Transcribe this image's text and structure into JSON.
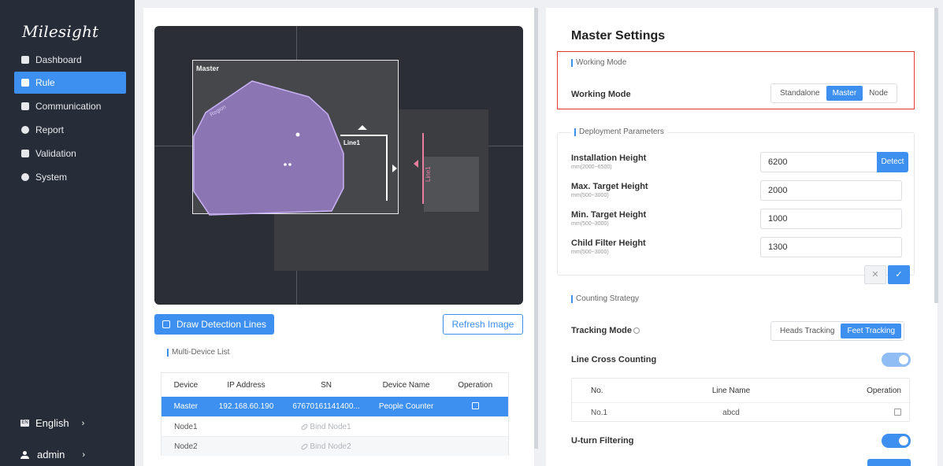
{
  "brand": "Milesight",
  "sidebar": {
    "items": [
      {
        "label": "Dashboard",
        "icon": "dashboard-icon"
      },
      {
        "label": "Rule",
        "icon": "rule-icon",
        "active": true
      },
      {
        "label": "Communication",
        "icon": "communication-icon"
      },
      {
        "label": "Report",
        "icon": "report-icon"
      },
      {
        "label": "Validation",
        "icon": "validation-icon"
      },
      {
        "label": "System",
        "icon": "gear-icon"
      }
    ],
    "language": "English",
    "user": "admin"
  },
  "preview": {
    "master_label": "Master",
    "region_label": "Region",
    "line_label": "Line1",
    "node_line_label": "Line1"
  },
  "left": {
    "draw_button": "Draw Detection Lines",
    "refresh_button": "Refresh Image",
    "device_list_title": "Multi-Device List",
    "columns": [
      "Device",
      "IP Address",
      "SN",
      "Device Name",
      "Operation"
    ],
    "rows": [
      {
        "device": "Master",
        "ip": "192.168.60.190",
        "sn": "67670161141400...",
        "name": "People Counter",
        "op": "edit"
      },
      {
        "device": "Node1",
        "ip": "",
        "sn": "Bind Node1",
        "name": "",
        "op": ""
      },
      {
        "device": "Node2",
        "ip": "",
        "sn": "Bind Node2",
        "name": "",
        "op": ""
      }
    ]
  },
  "right": {
    "title": "Master Settings",
    "working_mode_section": "Working Mode",
    "working_mode_label": "Working Mode",
    "working_mode_options": [
      "Standalone",
      "Master",
      "Node"
    ],
    "working_mode_selected": "Master",
    "deployment_section": "Deployment Parameters",
    "params": [
      {
        "label": "Installation Height",
        "range": "mm(2000~6500)",
        "value": "6200"
      },
      {
        "label": "Max. Target Height",
        "range": "mm(500~3000)",
        "value": "2000"
      },
      {
        "label": "Min. Target Height",
        "range": "mm(500~3000)",
        "value": "1000"
      },
      {
        "label": "Child Filter Height",
        "range": "mm(500~3000)",
        "value": "1300"
      }
    ],
    "detect_button": "Detect",
    "cancel_symbol": "✕",
    "confirm_symbol": "✓",
    "counting_section": "Counting Strategy",
    "tracking_mode_label": "Tracking Mode",
    "tracking_options": [
      "Heads Tracking",
      "Feet Tracking"
    ],
    "tracking_selected": "Feet Tracking",
    "line_cross_label": "Line Cross Counting",
    "line_cross_on": true,
    "line_table_columns": [
      "No.",
      "Line Name",
      "Operation"
    ],
    "line_rows": [
      {
        "no": "No.1",
        "name": "abcd"
      }
    ],
    "uturn_label": "U-turn Filtering",
    "uturn_on": true
  },
  "colors": {
    "accent": "#3d8ff0",
    "sidebar": "#262c38",
    "highlight": "#e53935",
    "region": "#a98ae0",
    "line_node": "#e87fa0"
  }
}
